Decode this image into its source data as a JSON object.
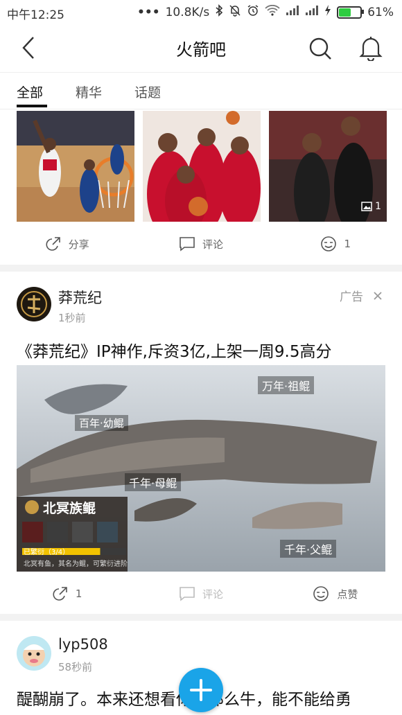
{
  "status": {
    "time": "中午12:25",
    "speed": "10.8K/s",
    "battery": "61%",
    "battery_level": 0.61
  },
  "header": {
    "title": "火箭吧"
  },
  "tabs": [
    {
      "label": "全部"
    },
    {
      "label": "精华"
    },
    {
      "label": "话题"
    }
  ],
  "post1": {
    "image_count": "1",
    "share_label": "分享",
    "comment_label": "评论",
    "like_count": "1"
  },
  "post2": {
    "username": "莽荒纪",
    "time": "1秒前",
    "ad_label": "广告",
    "text": "《莽荒纪》IP神作,斥资3亿,上架一周9.5高分",
    "banner": {
      "labels": [
        "万年·祖鲲",
        "百年·幼鲲",
        "千年·母鲲",
        "千年·父鲲"
      ],
      "clan": "北冥族鲲",
      "progress_text": "已繁衍（3/4）",
      "progress": 0.75,
      "caption": "北冥有鱼，其名为鲲，可繁衍进阶"
    },
    "share_count": "1",
    "comment_label": "评论",
    "like_label": "点赞"
  },
  "post3": {
    "username": "lyp508",
    "time": "58秒前",
    "text": "醍醐崩了。本来还想看你有那么牛，能不能给勇"
  },
  "colors": {
    "accent": "#1aa4e8",
    "rockets_red": "#c8102e"
  }
}
